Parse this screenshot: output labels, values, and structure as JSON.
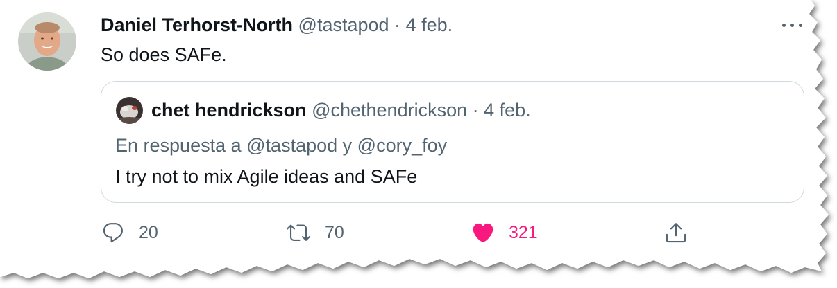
{
  "tweet": {
    "author_name": "Daniel Terhorst-North",
    "author_handle": "@tastapod",
    "separator": "·",
    "date": "4 feb.",
    "text": "So does SAFe."
  },
  "quoted_tweet": {
    "author_name": "chet hendrickson",
    "author_handle": "@chethendrickson",
    "separator": "·",
    "date": "4 feb.",
    "reply_prefix": "En respuesta a",
    "reply_to_1": "@tastapod",
    "reply_joiner": "y",
    "reply_to_2": "@cory_foy",
    "text": "I try not to mix Agile ideas and SAFe"
  },
  "actions": {
    "replies": "20",
    "retweets": "70",
    "likes": "321",
    "liked": true
  },
  "icons": {
    "reply": "reply-icon",
    "retweet": "retweet-icon",
    "like": "heart-icon",
    "share": "share-icon",
    "more": "more-icon"
  },
  "colors": {
    "text": "#0f1419",
    "muted": "#536471",
    "like": "#f91880",
    "border": "#cfd9de"
  }
}
